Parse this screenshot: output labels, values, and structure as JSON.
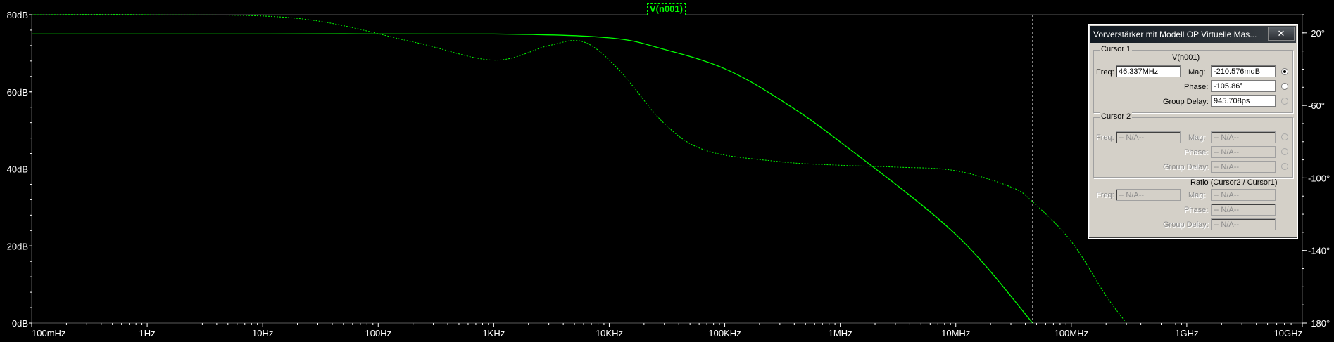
{
  "trace_label": "V(n001)",
  "colors": {
    "background": "#000000",
    "trace": "#00ff00",
    "axis": "#ffffff",
    "grid": "#5a5a5a",
    "cursor": "#ffffff"
  },
  "chart_data": {
    "type": "line",
    "x_scale": "log",
    "xlim_hz": [
      0.1,
      10000000000
    ],
    "ylim_db": [
      0,
      80
    ],
    "ylim_phase_deg": [
      -180,
      -10
    ],
    "x_tick_labels": [
      "100mHz",
      "1Hz",
      "10Hz",
      "100Hz",
      "1KHz",
      "10KHz",
      "100KHz",
      "1MHz",
      "10MHz",
      "100MHz",
      "1GHz",
      "10GHz"
    ],
    "y_tick_labels": [
      "80dB",
      "60dB",
      "40dB",
      "20dB",
      "0dB"
    ],
    "y2_tick_labels": [
      "-20°",
      "-60°",
      "-100°",
      "-140°",
      "-180°"
    ],
    "grid": false,
    "cursor_freq_hz": 46337000,
    "series": [
      {
        "name": "V(n001)",
        "style": "solid",
        "x_hz": [
          0.1,
          10,
          1000,
          10000,
          30000,
          100000,
          300000,
          1000000,
          10000000,
          46337000
        ],
        "y_db": [
          75,
          75,
          75,
          74,
          71,
          66,
          58,
          47,
          23,
          0
        ]
      },
      {
        "name": "V(n001)",
        "style": "dashed",
        "x_hz": [
          0.1,
          1,
          20,
          200,
          1000,
          3000,
          6000,
          12000,
          30000,
          70000,
          300000,
          1000000,
          3000000,
          10000000,
          30000000,
          46000000,
          100000000,
          200000000,
          300000000
        ],
        "y_phase_deg": [
          -10,
          -10,
          -12,
          -25,
          -35,
          -27,
          -25,
          -40,
          -70,
          -85,
          -91,
          -93,
          -94,
          -96,
          -105,
          -113,
          -135,
          -165,
          -180
        ]
      }
    ]
  },
  "dialog": {
    "title": "Vorverstärker mit Modell OP Virtuelle Mas...",
    "close_label": "✕",
    "cursor1": {
      "title": "Cursor 1",
      "trace": "V(n001)",
      "freq_label": "Freq:",
      "freq": "46.337MHz",
      "mag_label": "Mag:",
      "mag": "-210.576mdB",
      "phase_label": "Phase:",
      "phase": "-105.86°",
      "gd_label": "Group Delay:",
      "gd": "945.708ps"
    },
    "cursor2": {
      "title": "Cursor 2",
      "freq_label": "Freq:",
      "freq": "-- N/A--",
      "mag_label": "Mag:",
      "mag": "-- N/A--",
      "phase_label": "Phase:",
      "phase": "-- N/A--",
      "gd_label": "Group Delay:",
      "gd": "-- N/A--"
    },
    "ratio": {
      "title": "Ratio (Cursor2 / Cursor1)",
      "freq_label": "Freq:",
      "freq": "-- N/A--",
      "mag_label": "Mag:",
      "mag": "-- N/A--",
      "phase_label": "Phase:",
      "phase": "-- N/A--",
      "gd_label": "Group Delay:",
      "gd": "-- N/A--"
    }
  }
}
